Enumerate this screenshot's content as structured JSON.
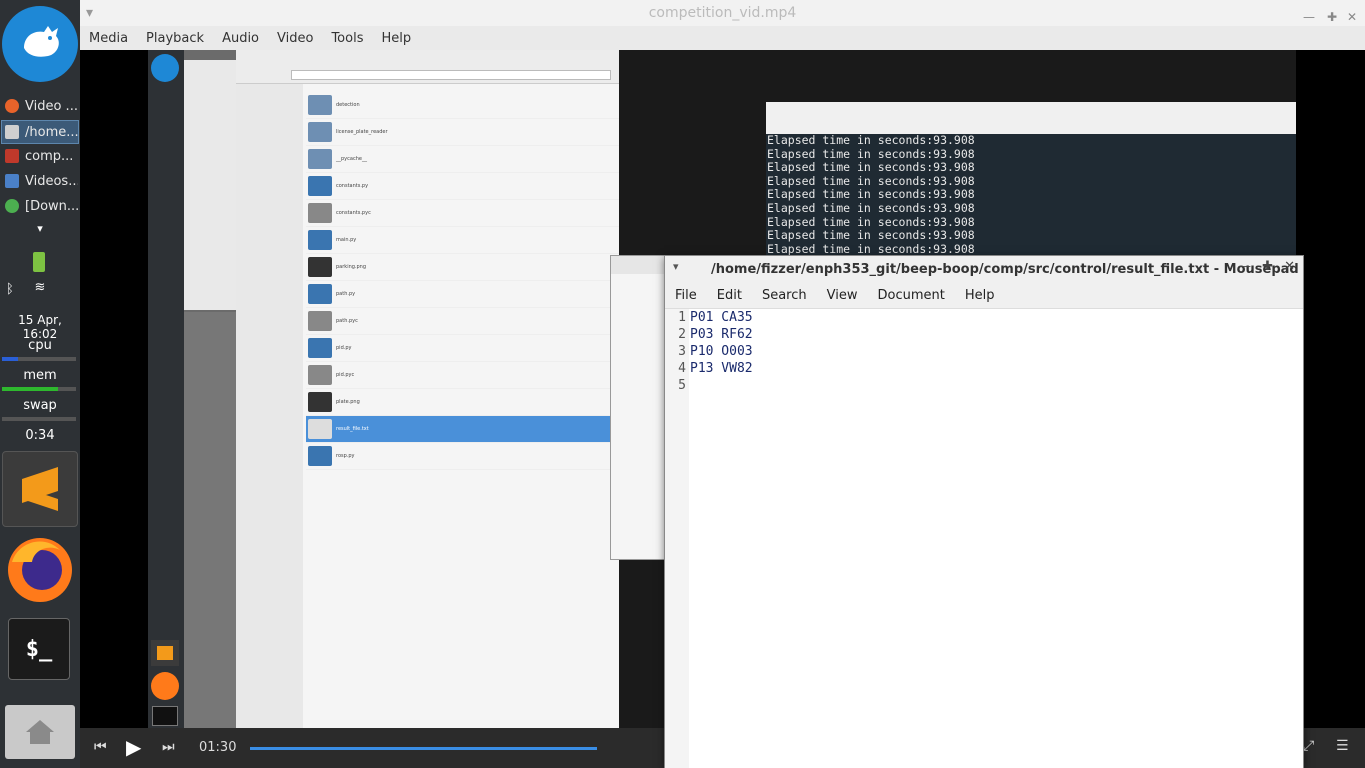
{
  "dock": {
    "tasks": [
      {
        "label": "Video ...",
        "color": "#e8632a"
      },
      {
        "label": "/home...",
        "color": "#cfcfcf",
        "active": true
      },
      {
        "label": "comp...",
        "color": "#c0392b"
      },
      {
        "label": "Videos...",
        "color": "#4a80c8"
      },
      {
        "label": "[Down...",
        "color": "#4caf50"
      }
    ],
    "datetime": "15 Apr, 16:02",
    "cpu_label": "cpu",
    "mem_label": "mem",
    "swap_label": "swap",
    "uptime": "0:34",
    "terminal_label": "$_"
  },
  "player": {
    "title": "competition_vid.mp4",
    "menu": [
      "Media",
      "Playback",
      "Audio",
      "Video",
      "Tools",
      "Help"
    ],
    "time_elapsed": "01:30",
    "progress": 0.33
  },
  "terminal": {
    "lines": [
      "Elapsed time in seconds:93.908",
      "Elapsed time in seconds:93.908",
      "Elapsed time in seconds:93.908",
      "Elapsed time in seconds:93.908",
      "Elapsed time in seconds:93.908",
      "Elapsed time in seconds:93.908",
      "Elapsed time in seconds:93.908",
      "Elapsed time in seconds:93.908",
      "Elapsed time in seconds:93.908"
    ]
  },
  "file_manager": {
    "files": [
      {
        "name": "detection",
        "icon": "folder"
      },
      {
        "name": "license_plate_reader",
        "icon": "folder"
      },
      {
        "name": "__pycache__",
        "icon": "folder"
      },
      {
        "name": "constants.py",
        "icon": "python"
      },
      {
        "name": "constants.pyc",
        "icon": "gear"
      },
      {
        "name": "main.py",
        "icon": "python"
      },
      {
        "name": "parking.png",
        "icon": "image-P13"
      },
      {
        "name": "path.py",
        "icon": "python"
      },
      {
        "name": "path.pyc",
        "icon": "gear"
      },
      {
        "name": "pid.py",
        "icon": "python"
      },
      {
        "name": "pid.pyc",
        "icon": "gear"
      },
      {
        "name": "plate.png",
        "icon": "image-VW82"
      },
      {
        "name": "result_file.txt",
        "icon": "text",
        "selected": true
      },
      {
        "name": "rosp.py",
        "icon": "python"
      }
    ]
  },
  "mousepad": {
    "title": "/home/fizzer/enph353_git/beep-boop/comp/src/control/result_file.txt - Mousepad",
    "menu": [
      "File",
      "Edit",
      "Search",
      "View",
      "Document",
      "Help"
    ],
    "line_numbers": [
      "1",
      "2",
      "3",
      "4",
      "5"
    ],
    "lines": [
      "P01 CA35",
      "P03 RF62",
      "P10 O003",
      "P13 VW82",
      ""
    ]
  }
}
